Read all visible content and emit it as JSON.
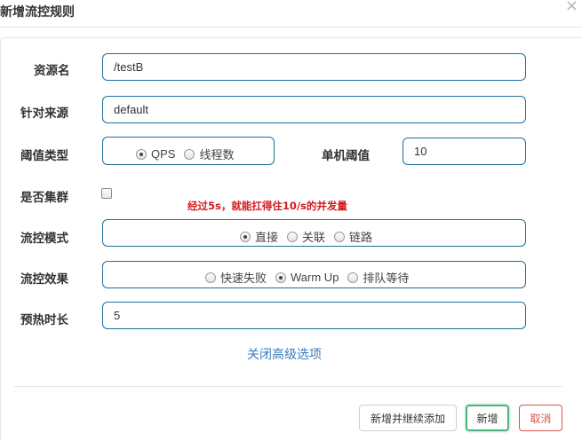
{
  "dialog": {
    "title": "新增流控规则",
    "close": "×"
  },
  "form": {
    "resource": {
      "label": "资源名",
      "value": "/testB"
    },
    "limit_app": {
      "label": "针对来源",
      "value": "default"
    },
    "threshold_type": {
      "label": "阈值类型",
      "options": [
        "QPS",
        "线程数"
      ],
      "selected": "QPS"
    },
    "single_threshold": {
      "label": "单机阈值",
      "value": "10"
    },
    "cluster": {
      "label": "是否集群",
      "checked": false
    },
    "annotation": "经过5s，就能扛得住10/s的并发量",
    "strategy": {
      "label": "流控模式",
      "options": [
        "直接",
        "关联",
        "链路"
      ],
      "selected": "直接"
    },
    "control_behavior": {
      "label": "流控效果",
      "options": [
        "快速失败",
        "Warm Up",
        "排队等待"
      ],
      "selected": "Warm Up"
    },
    "warmup": {
      "label": "预热时长",
      "value": "5"
    },
    "advanced_toggle": "关闭高级选项"
  },
  "footer": {
    "add_continue": "新增并继续添加",
    "add": "新增",
    "cancel": "取消"
  },
  "colors": {
    "field_border": "#1f6f9c",
    "link": "#3a7bbf",
    "annotation": "#d2191f",
    "add_border": "#4cb27d",
    "cancel": "#d9534f"
  }
}
